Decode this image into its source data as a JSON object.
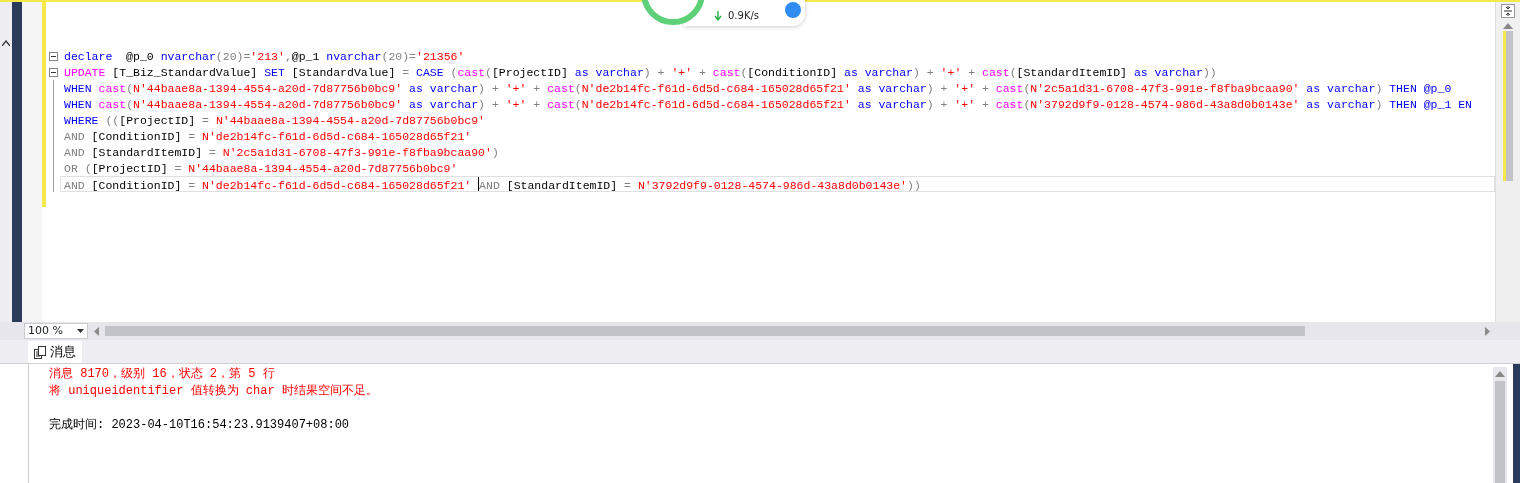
{
  "editor": {
    "lines": [
      {
        "fold": true,
        "current": false,
        "tokens": [
          {
            "kind": "keyword",
            "text": "declare"
          },
          {
            "kind": "plain",
            "text": "  @p_0 "
          },
          {
            "kind": "keyword",
            "text": "nvarchar"
          },
          {
            "kind": "operator",
            "text": "(20)="
          },
          {
            "kind": "string",
            "text": "'213'"
          },
          {
            "kind": "operator",
            "text": ","
          },
          {
            "kind": "plain",
            "text": "@p_1 "
          },
          {
            "kind": "keyword",
            "text": "nvarchar"
          },
          {
            "kind": "operator",
            "text": "(20)="
          },
          {
            "kind": "string",
            "text": "'21356'"
          }
        ]
      },
      {
        "fold": true,
        "current": false,
        "tokens": [
          {
            "kind": "function",
            "text": "UPDATE"
          },
          {
            "kind": "plain",
            "text": " [T_Biz_StandardValue] "
          },
          {
            "kind": "keyword",
            "text": "SET"
          },
          {
            "kind": "plain",
            "text": " [StandardValue] "
          },
          {
            "kind": "operator",
            "text": "= "
          },
          {
            "kind": "keyword",
            "text": "CASE"
          },
          {
            "kind": "operator",
            "text": " ("
          },
          {
            "kind": "function",
            "text": "cast"
          },
          {
            "kind": "operator",
            "text": "("
          },
          {
            "kind": "plain",
            "text": "[ProjectID] "
          },
          {
            "kind": "keyword",
            "text": "as varchar"
          },
          {
            "kind": "operator",
            "text": ") + "
          },
          {
            "kind": "string",
            "text": "'+'"
          },
          {
            "kind": "operator",
            "text": " + "
          },
          {
            "kind": "function",
            "text": "cast"
          },
          {
            "kind": "operator",
            "text": "("
          },
          {
            "kind": "plain",
            "text": "[ConditionID] "
          },
          {
            "kind": "keyword",
            "text": "as varchar"
          },
          {
            "kind": "operator",
            "text": ") + "
          },
          {
            "kind": "string",
            "text": "'+'"
          },
          {
            "kind": "operator",
            "text": " + "
          },
          {
            "kind": "function",
            "text": "cast"
          },
          {
            "kind": "operator",
            "text": "("
          },
          {
            "kind": "plain",
            "text": "[StandardItemID] "
          },
          {
            "kind": "keyword",
            "text": "as varchar"
          },
          {
            "kind": "operator",
            "text": "))"
          }
        ]
      },
      {
        "fold": false,
        "current": false,
        "tokens": [
          {
            "kind": "keyword",
            "text": "WHEN "
          },
          {
            "kind": "function",
            "text": "cast"
          },
          {
            "kind": "operator",
            "text": "("
          },
          {
            "kind": "string",
            "text": "N'44baae8a-1394-4554-a20d-7d87756b0bc9'"
          },
          {
            "kind": "keyword",
            "text": " as varchar"
          },
          {
            "kind": "operator",
            "text": ") + "
          },
          {
            "kind": "string",
            "text": "'+'"
          },
          {
            "kind": "operator",
            "text": " + "
          },
          {
            "kind": "function",
            "text": "cast"
          },
          {
            "kind": "operator",
            "text": "("
          },
          {
            "kind": "string",
            "text": "N'de2b14fc-f61d-6d5d-c684-165028d65f21'"
          },
          {
            "kind": "keyword",
            "text": " as varchar"
          },
          {
            "kind": "operator",
            "text": ") + "
          },
          {
            "kind": "string",
            "text": "'+'"
          },
          {
            "kind": "operator",
            "text": " + "
          },
          {
            "kind": "function",
            "text": "cast"
          },
          {
            "kind": "operator",
            "text": "("
          },
          {
            "kind": "string",
            "text": "N'2c5a1d31-6708-47f3-991e-f8fba9bcaa90'"
          },
          {
            "kind": "keyword",
            "text": " as varchar"
          },
          {
            "kind": "operator",
            "text": ") "
          },
          {
            "kind": "keyword",
            "text": "THEN @p_0"
          }
        ]
      },
      {
        "fold": false,
        "current": false,
        "tokens": [
          {
            "kind": "keyword",
            "text": "WHEN "
          },
          {
            "kind": "function",
            "text": "cast"
          },
          {
            "kind": "operator",
            "text": "("
          },
          {
            "kind": "string",
            "text": "N'44baae8a-1394-4554-a20d-7d87756b0bc9'"
          },
          {
            "kind": "keyword",
            "text": " as varchar"
          },
          {
            "kind": "operator",
            "text": ") + "
          },
          {
            "kind": "string",
            "text": "'+'"
          },
          {
            "kind": "operator",
            "text": " + "
          },
          {
            "kind": "function",
            "text": "cast"
          },
          {
            "kind": "operator",
            "text": "("
          },
          {
            "kind": "string",
            "text": "N'de2b14fc-f61d-6d5d-c684-165028d65f21'"
          },
          {
            "kind": "keyword",
            "text": " as varchar"
          },
          {
            "kind": "operator",
            "text": ") + "
          },
          {
            "kind": "string",
            "text": "'+'"
          },
          {
            "kind": "operator",
            "text": " + "
          },
          {
            "kind": "function",
            "text": "cast"
          },
          {
            "kind": "operator",
            "text": "("
          },
          {
            "kind": "string",
            "text": "N'3792d9f9-0128-4574-986d-43a8d0b0143e'"
          },
          {
            "kind": "keyword",
            "text": " as varchar"
          },
          {
            "kind": "operator",
            "text": ") "
          },
          {
            "kind": "keyword",
            "text": "THEN @p_1 EN"
          }
        ]
      },
      {
        "fold": false,
        "current": false,
        "tokens": [
          {
            "kind": "keyword",
            "text": "WHERE"
          },
          {
            "kind": "operator",
            "text": " (("
          },
          {
            "kind": "plain",
            "text": "[ProjectID] "
          },
          {
            "kind": "operator",
            "text": "= "
          },
          {
            "kind": "string",
            "text": "N'44baae8a-1394-4554-a20d-7d87756b0bc9'"
          }
        ]
      },
      {
        "fold": false,
        "current": false,
        "tokens": [
          {
            "kind": "operator",
            "text": "AND"
          },
          {
            "kind": "plain",
            "text": " [ConditionID] "
          },
          {
            "kind": "operator",
            "text": "= "
          },
          {
            "kind": "string",
            "text": "N'de2b14fc-f61d-6d5d-c684-165028d65f21'"
          }
        ]
      },
      {
        "fold": false,
        "current": false,
        "tokens": [
          {
            "kind": "operator",
            "text": "AND"
          },
          {
            "kind": "plain",
            "text": " [StandardItemID] "
          },
          {
            "kind": "operator",
            "text": "= "
          },
          {
            "kind": "string",
            "text": "N'2c5a1d31-6708-47f3-991e-f8fba9bcaa90'"
          },
          {
            "kind": "operator",
            "text": ")"
          }
        ]
      },
      {
        "fold": false,
        "current": false,
        "tokens": [
          {
            "kind": "operator",
            "text": "OR"
          },
          {
            "kind": "operator",
            "text": " ("
          },
          {
            "kind": "plain",
            "text": "[ProjectID] "
          },
          {
            "kind": "operator",
            "text": "= "
          },
          {
            "kind": "string",
            "text": "N'44baae8a-1394-4554-a20d-7d87756b0bc9'"
          }
        ]
      },
      {
        "fold": false,
        "current": true,
        "tokens": [
          {
            "kind": "operator",
            "text": "AND"
          },
          {
            "kind": "plain",
            "text": " [ConditionID] "
          },
          {
            "kind": "operator",
            "text": "= "
          },
          {
            "kind": "string",
            "text": "N'de2b14fc-f61d-6d5d-c684-165028d65f21' "
          }
        ],
        "after_caret": [
          {
            "kind": "operator",
            "text": "AND"
          },
          {
            "kind": "plain",
            "text": " [StandardItemID] "
          },
          {
            "kind": "operator",
            "text": "= "
          },
          {
            "kind": "string",
            "text": "N'3792d9f9-0128-4574-986d-43a8d0b0143e'"
          },
          {
            "kind": "operator",
            "text": "))"
          }
        ]
      }
    ]
  },
  "zoom": {
    "value": "100 %"
  },
  "results": {
    "tabs": [
      {
        "label": "消息",
        "selected": true
      }
    ],
    "messages": [
      {
        "kind": "error",
        "text": "消息 8170，级别 16，状态 2，第 5 行"
      },
      {
        "kind": "error",
        "text": "将 uniqueidentifier 值转换为 char 时结果空间不足。"
      },
      {
        "kind": "info",
        "text": "完成时间: 2023-04-10T16:54:23.9139407+08:00"
      }
    ]
  },
  "overlay": {
    "speed": "0.9K/s"
  }
}
